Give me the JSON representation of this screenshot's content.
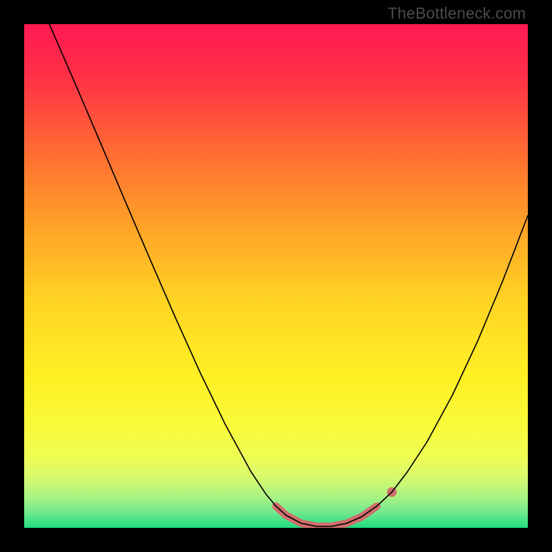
{
  "watermark": "TheBottleneck.com",
  "gradient": {
    "stops": [
      {
        "offset": 0.0,
        "color": "#ff1a52"
      },
      {
        "offset": 0.1,
        "color": "#ff2f47"
      },
      {
        "offset": 0.25,
        "color": "#ff6b33"
      },
      {
        "offset": 0.4,
        "color": "#ffa227"
      },
      {
        "offset": 0.55,
        "color": "#ffd423"
      },
      {
        "offset": 0.7,
        "color": "#fff024"
      },
      {
        "offset": 0.8,
        "color": "#f8fb3a"
      },
      {
        "offset": 0.86,
        "color": "#edfd55"
      },
      {
        "offset": 0.9,
        "color": "#d6fa6e"
      },
      {
        "offset": 0.94,
        "color": "#a8f283"
      },
      {
        "offset": 0.97,
        "color": "#6fe98e"
      },
      {
        "offset": 1.0,
        "color": "#1fdc7f"
      }
    ]
  },
  "chart_data": {
    "type": "line",
    "title": "",
    "xlabel": "",
    "ylabel": "",
    "x_range": [
      0,
      100
    ],
    "y_range": [
      0,
      100
    ],
    "series": [
      {
        "name": "main-curve",
        "color": "#000000",
        "width": 1.7,
        "points": [
          {
            "x": 5.0,
            "y": 100.0
          },
          {
            "x": 10.0,
            "y": 88.5
          },
          {
            "x": 15.0,
            "y": 76.8
          },
          {
            "x": 20.0,
            "y": 65.0
          },
          {
            "x": 25.0,
            "y": 53.3
          },
          {
            "x": 30.0,
            "y": 41.8
          },
          {
            "x": 35.0,
            "y": 30.7
          },
          {
            "x": 40.0,
            "y": 20.4
          },
          {
            "x": 45.0,
            "y": 11.2
          },
          {
            "x": 48.0,
            "y": 6.7
          },
          {
            "x": 50.0,
            "y": 4.3
          },
          {
            "x": 52.0,
            "y": 2.5
          },
          {
            "x": 55.0,
            "y": 0.9
          },
          {
            "x": 58.0,
            "y": 0.3
          },
          {
            "x": 61.0,
            "y": 0.3
          },
          {
            "x": 64.0,
            "y": 0.9
          },
          {
            "x": 67.0,
            "y": 2.2
          },
          {
            "x": 70.0,
            "y": 4.3
          },
          {
            "x": 73.0,
            "y": 7.1
          },
          {
            "x": 76.0,
            "y": 11.0
          },
          {
            "x": 80.0,
            "y": 17.1
          },
          {
            "x": 85.0,
            "y": 26.3
          },
          {
            "x": 90.0,
            "y": 37.0
          },
          {
            "x": 95.0,
            "y": 49.0
          },
          {
            "x": 100.0,
            "y": 62.0
          }
        ]
      },
      {
        "name": "highlight-band",
        "color": "#d26d6d",
        "width": 11,
        "linecap": "round",
        "points": [
          {
            "x": 50.0,
            "y": 4.3
          },
          {
            "x": 52.0,
            "y": 2.5
          },
          {
            "x": 55.0,
            "y": 0.9
          },
          {
            "x": 58.0,
            "y": 0.3
          },
          {
            "x": 61.0,
            "y": 0.3
          },
          {
            "x": 64.0,
            "y": 0.9
          },
          {
            "x": 67.0,
            "y": 2.2
          },
          {
            "x": 70.0,
            "y": 4.3
          }
        ]
      },
      {
        "name": "highlight-dot",
        "color": "#d26d6d",
        "type": "point",
        "radius": 7,
        "points": [
          {
            "x": 73.0,
            "y": 7.1
          }
        ]
      }
    ]
  }
}
